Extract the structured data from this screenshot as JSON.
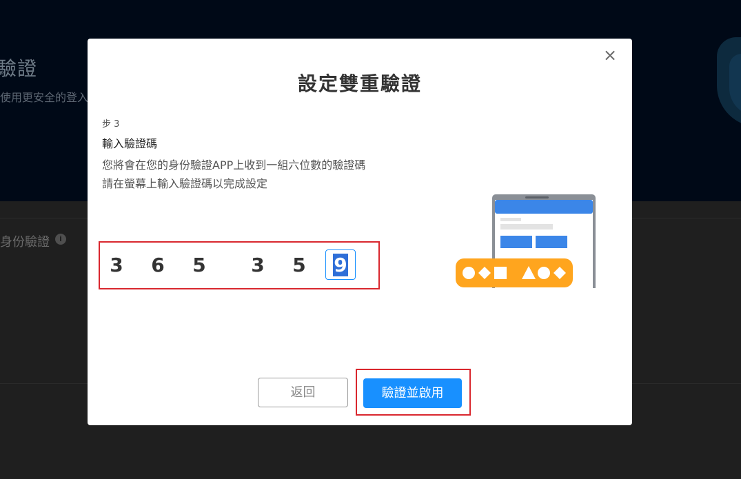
{
  "background": {
    "title": "驗證",
    "description": "使用更安全的登入",
    "identity_label": "身份驗證",
    "info_icon": "i"
  },
  "modal": {
    "title": "設定雙重驗證",
    "close_icon": "×",
    "step_label": "步 3",
    "step_heading": "輸入驗證碼",
    "desc_line1": "您將會在您的身份驗證APP上收到一組六位數的驗證碼",
    "desc_line2": "請在螢幕上輸入驗證碼以完成設定",
    "code_digits": [
      "3",
      "6",
      "5",
      "3",
      "5",
      "9"
    ],
    "back_label": "返回",
    "verify_label": "驗證並啟用"
  },
  "colors": {
    "primary": "#1890ff",
    "highlight_red": "#d9272e",
    "illustration_orange": "#ffa51e"
  }
}
